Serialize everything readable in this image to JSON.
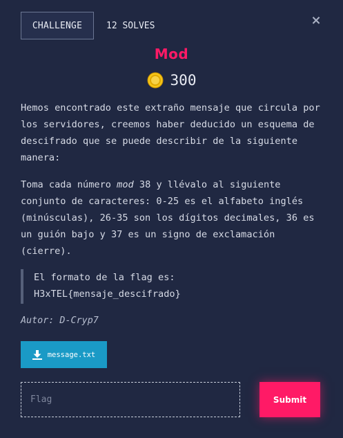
{
  "tabs": {
    "challenge_label": "CHALLENGE",
    "solves_label": "12 SOLVES"
  },
  "close_label": "×",
  "challenge": {
    "title": "Mod",
    "points": "300",
    "description_p1": "Hemos encontrado este extraño mensaje que circula por los servidores, creemos haber deducido un esquema de descifrado que se puede describir de la siguiente manera:",
    "description_p2_prefix": "Toma cada número ",
    "description_p2_mod": "mod",
    "description_p2_rest": " 38 y llévalo al siguiente conjunto de caracteres: 0-25 es el alfabeto inglés (minúsculas), 26-35 son los dígitos decimales, 36 es un guión bajo y 37 es un signo de exclamación (cierre).",
    "flag_format_line1": "El formato de la flag es:",
    "flag_format_line2": "H3xTEL{mensaje_descifrado}",
    "author": "Autor: D-Cryp7"
  },
  "file": {
    "name": "message.txt"
  },
  "form": {
    "flag_placeholder": "Flag",
    "flag_value": "",
    "submit_label": "Submit"
  },
  "colors": {
    "background": "#202842",
    "accent": "#ff1a66",
    "download": "#1a9ac6",
    "coin": "#f5c518"
  }
}
